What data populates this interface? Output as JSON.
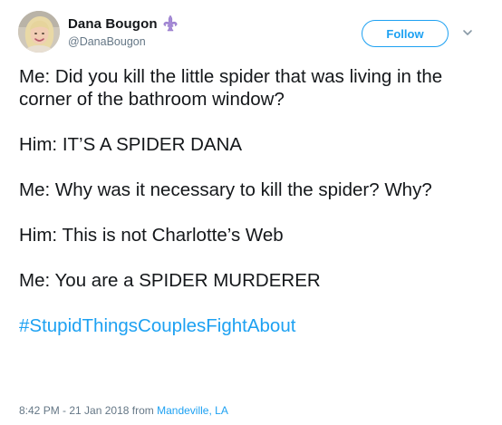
{
  "author": {
    "display_name": "Dana Bougon",
    "handle": "@DanaBougon",
    "badge_icon": "fleur-de-lis-icon",
    "avatar_icon": "profile-photo"
  },
  "actions": {
    "follow_label": "Follow",
    "menu_icon": "chevron-down-icon"
  },
  "tweet": {
    "lines": [
      "Me: Did you kill the little spider that was living in the corner of the bathroom window?",
      "Him: IT’S A SPIDER DANA",
      "Me: Why was it necessary to kill the spider? Why?",
      "Him: This is not Charlotte’s Web",
      "Me: You are a SPIDER MURDERER"
    ],
    "hashtag": "#StupidThingsCouplesFightAbout"
  },
  "meta": {
    "timestamp": "8:42 PM - 21 Jan 2018",
    "from_label": "from",
    "location": "Mandeville, LA"
  },
  "colors": {
    "accent": "#1da1f2",
    "text": "#14171a",
    "secondary": "#657786",
    "badge": "#a58ad6"
  }
}
